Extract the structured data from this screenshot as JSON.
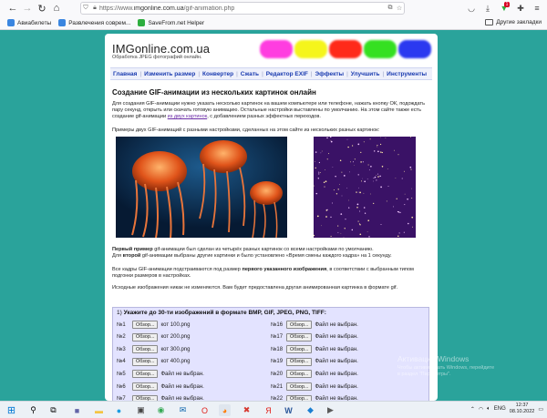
{
  "browser": {
    "url_prefix": "https://www.",
    "url_domain": "imgonline.com.ua",
    "url_path": "/gif-animation.php",
    "bookmarks": [
      {
        "label": "Авиабилеты",
        "color": "#3a86e0"
      },
      {
        "label": "Развлечения соврем...",
        "color": "#3a86e0"
      },
      {
        "label": "SaveFrom.net Helper",
        "color": "#2eae3f"
      }
    ],
    "other_bookmarks": "Другие закладки",
    "badge_count": "1"
  },
  "site": {
    "title": "IMGonline.com.ua",
    "subtitle": "Обработка JPEG фотографий онлайн.",
    "blob_colors": [
      "#ff3de0",
      "#f5f51b",
      "#ff2a1a",
      "#35e021",
      "#2b39f0"
    ],
    "menu": [
      "Главная",
      "Изменить размер",
      "Конвертер",
      "Сжать",
      "Редактор EXIF",
      "Эффекты",
      "Улучшить",
      "Инструменты"
    ]
  },
  "content": {
    "heading": "Создание GIF-анимации из нескольких картинок онлайн",
    "p1": "Для создания GIF-анимации нужно указать несколько картинок на вашем компьютере или телефоне, нажать кнопку ОК, подождать пару секунд, открыть или скачать готовую анимацию. Остальные настройки выставлены по умолчанию. На этом сайте также есть создание gif-анимации ",
    "p1_link": "из двух картинок",
    "p1_end": ", с добавлением разных эффектных переходов.",
    "p2": "Примеры двух GIF-анимаций с разными настройками, сделанных на этом сайте из нескольких разных картинок:",
    "p3_b1": "Первый пример",
    "p3_t1": " gif-анимации был сделан из четырёх разных картинок со всеми настройками по умолчанию.",
    "p3_t2": "Для ",
    "p3_b2": "второй",
    "p3_t3": " gif-анимации выбраны другие картинки и было установлено «Время смены каждого кадра» на 1 секунду.",
    "p4_t1": "Все кадры GIF-анимации подстраиваются под размер ",
    "p4_b": "первого указанного изображения",
    "p4_t2": ", в соответствии с выбранным типом подгонки размеров в настройках.",
    "p5": "Исходные изображения никак не изменяются. Вам будет предоставлена другая анимированная картинка в формате gif."
  },
  "upload": {
    "step": "1)",
    "title": "Укажите до 30-ти изображений в формате BMP, GIF, JPEG, PNG, TIFF:",
    "button_label": "Обзор...",
    "left_rows": [
      {
        "n": "№1",
        "file": "кот 100.png"
      },
      {
        "n": "№2",
        "file": "кот 200.png"
      },
      {
        "n": "№3",
        "file": "кот 300.png"
      },
      {
        "n": "№4",
        "file": "кот 400.png"
      },
      {
        "n": "№5",
        "file": "Файл не выбран."
      },
      {
        "n": "№6",
        "file": "Файл не выбран."
      },
      {
        "n": "№7",
        "file": "Файл не выбран."
      }
    ],
    "right_rows": [
      {
        "n": "№16",
        "file": "Файл не выбран."
      },
      {
        "n": "№17",
        "file": "Файл не выбран."
      },
      {
        "n": "№18",
        "file": "Файл не выбран."
      },
      {
        "n": "№19",
        "file": "Файл не выбран."
      },
      {
        "n": "№20",
        "file": "Файл не выбран."
      },
      {
        "n": "№21",
        "file": "Файл не выбран."
      },
      {
        "n": "№22",
        "file": "Файл не выбран."
      }
    ]
  },
  "watermark": {
    "line1": "Активация Windows",
    "line2": "Чтобы активировать Windows, перейдите в раздел \"Параметры\"."
  },
  "taskbar": {
    "lang": "ENG",
    "time": "12:37",
    "date": "08.10.2022"
  }
}
